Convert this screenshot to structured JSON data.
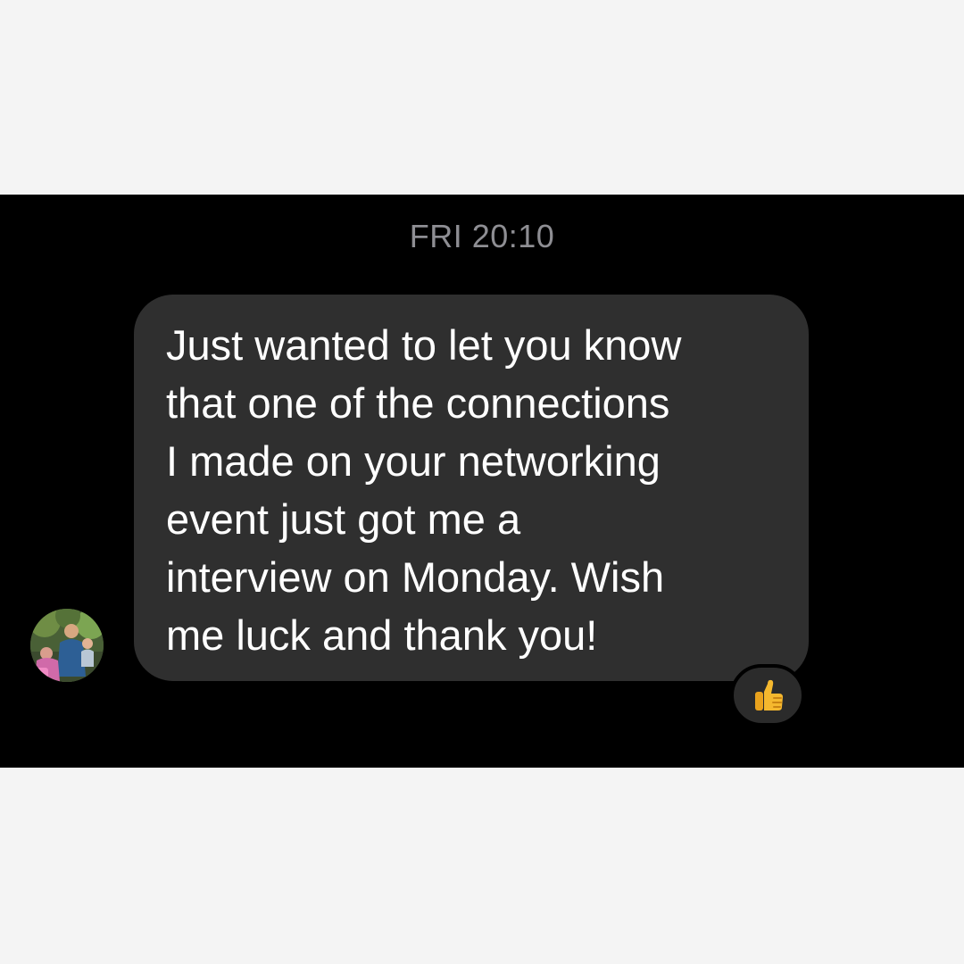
{
  "conversation": {
    "timestamp": "FRI 20:10"
  },
  "message": {
    "lines": [
      "Just wanted to let you know",
      "that one of the connections",
      "I made on your networking",
      "event just got me a",
      "interview on Monday. Wish",
      "me luck and thank you!"
    ],
    "reaction_icon": "thumbs-up-icon"
  },
  "colors": {
    "panel_background": "#000000",
    "page_background": "#f4f4f4",
    "bubble_background": "#2f2f2f",
    "timestamp_text": "#8e8e93",
    "message_text": "#ffffff",
    "reaction_emoji": "#f5b82e"
  }
}
